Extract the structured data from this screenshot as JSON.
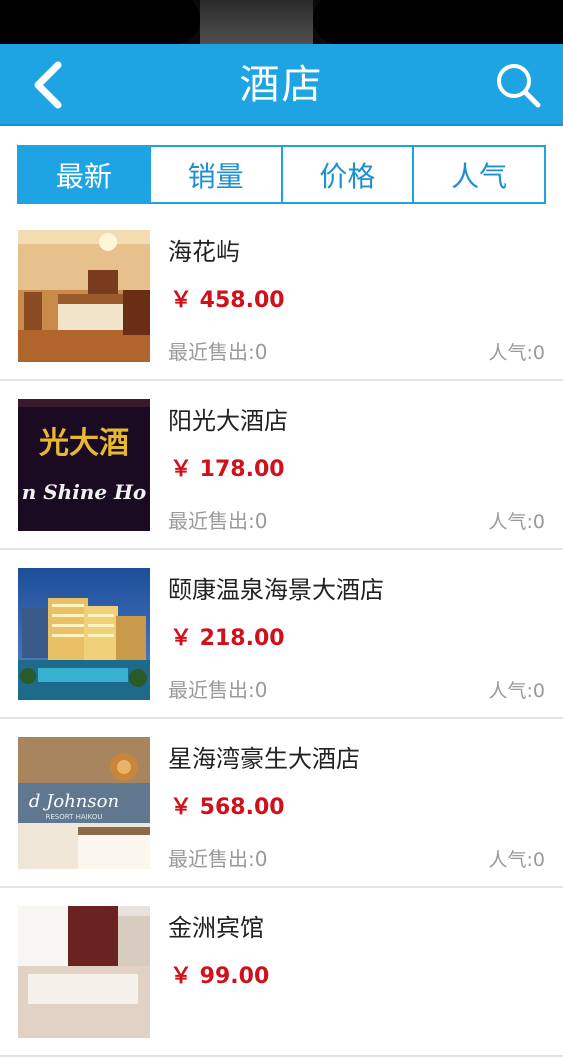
{
  "header": {
    "title": "酒店",
    "back_icon": "back-chevron-icon",
    "search_icon": "search-icon"
  },
  "tabs": [
    {
      "label": "最新",
      "active": true
    },
    {
      "label": "销量",
      "active": false
    },
    {
      "label": "价格",
      "active": false
    },
    {
      "label": "人气",
      "active": false
    }
  ],
  "hotels": [
    {
      "name": "海花屿",
      "price": "￥ 458.00",
      "sold": "最近售出:0",
      "popularity": "人气:0"
    },
    {
      "name": "阳光大酒店",
      "price": "￥ 178.00",
      "sold": "最近售出:0",
      "popularity": "人气:0",
      "sign_text": "光大酒",
      "sign_subtext": "n Shine Ho"
    },
    {
      "name": "颐康温泉海景大酒店",
      "price": "￥ 218.00",
      "sold": "最近售出:0",
      "popularity": "人气:0"
    },
    {
      "name": "星海湾豪生大酒店",
      "price": "￥ 568.00",
      "sold": "最近售出:0",
      "popularity": "人气:0",
      "sign_text": "d Johnson",
      "sign_subtext": "RESORT HAIKOU"
    },
    {
      "name": "金洲宾馆",
      "price": "￥ 99.00",
      "sold": "",
      "popularity": ""
    }
  ],
  "colors": {
    "accent": "#1ea4e3",
    "price": "#d0101a",
    "muted": "#9a9a9a"
  }
}
